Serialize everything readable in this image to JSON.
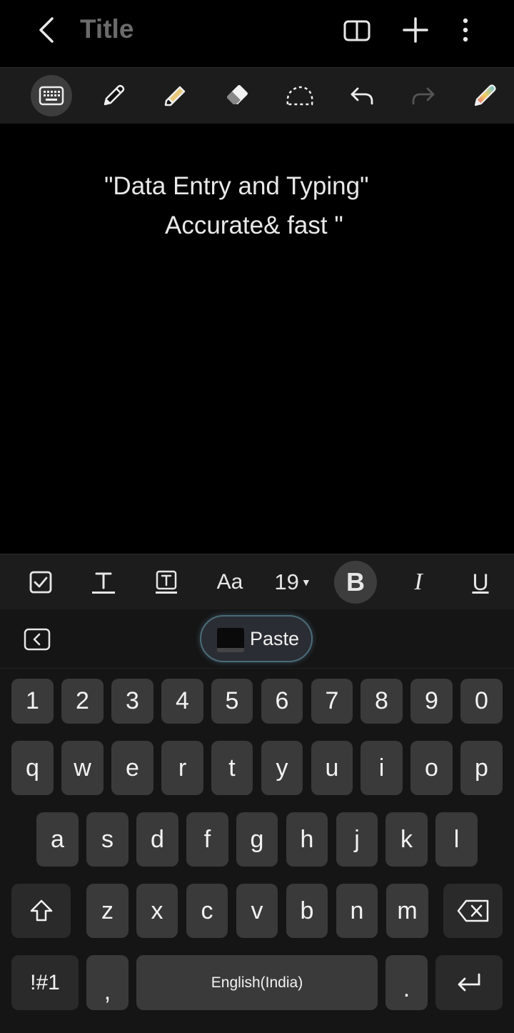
{
  "header": {
    "title": "Title"
  },
  "icons": {
    "back": "back-chevron-icon",
    "book": "reading-mode-icon",
    "add": "add-icon",
    "more": "more-vertical-icon",
    "keyboard": "keyboard-icon",
    "pen": "pen-icon",
    "highlighter": "highlighter-icon",
    "eraser": "eraser-icon",
    "lasso": "lasso-select-icon",
    "undo": "undo-icon",
    "redo": "redo-icon",
    "pen_settings": "pen-settings-icon"
  },
  "note": {
    "line1": "\"Data Entry and Typing\"",
    "line2": "Accurate& fast \""
  },
  "format_bar": {
    "font_label": "Aa",
    "font_size": "19",
    "bold": "B",
    "italic": "I",
    "underline": "U"
  },
  "keyboard": {
    "paste_label": "Paste",
    "row_numbers": [
      "1",
      "2",
      "3",
      "4",
      "5",
      "6",
      "7",
      "8",
      "9",
      "0"
    ],
    "row1": [
      "q",
      "w",
      "e",
      "r",
      "t",
      "y",
      "u",
      "i",
      "o",
      "p"
    ],
    "row2": [
      "a",
      "s",
      "d",
      "f",
      "g",
      "h",
      "j",
      "k",
      "l"
    ],
    "row3": [
      "z",
      "x",
      "c",
      "v",
      "b",
      "n",
      "m"
    ],
    "symbols_label": "!#1",
    "comma": ",",
    "space_label": "English(India)",
    "period": "."
  },
  "colors": {
    "accent_border": "#4a6b78",
    "key_bg": "#3a3a3a",
    "toolbar_bg": "#1c1c1c"
  }
}
